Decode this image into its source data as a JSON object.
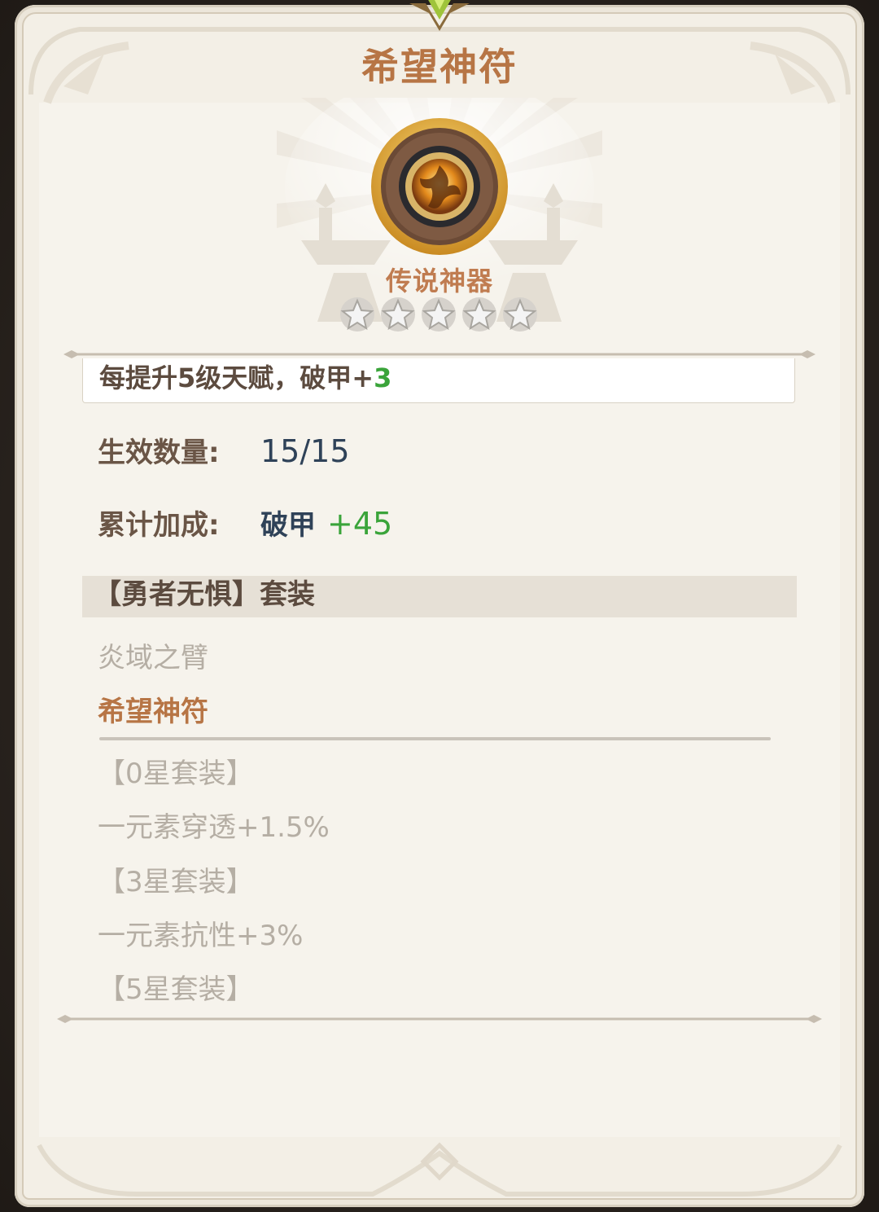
{
  "title": "希望神符",
  "rarity_label": "传说神器",
  "star_count": 5,
  "effect": {
    "prefix": "每提升5级天赋，破甲+",
    "value": "3"
  },
  "active_count": {
    "label": "生效数量:",
    "value": "15/15"
  },
  "total_bonus": {
    "label": "累计加成:",
    "stat": "破甲",
    "value": "+45"
  },
  "set": {
    "header": "【勇者无惧】套装",
    "pieces": [
      "炎域之臂",
      "希望神符"
    ],
    "bonuses": [
      {
        "tier": "【0星套装】",
        "effect": "一元素穿透+1.5%"
      },
      {
        "tier": "【3星套装】",
        "effect": "一元素抗性+3%"
      },
      {
        "tier": "【5星套装】"
      }
    ]
  },
  "colors": {
    "title": "#b77545",
    "highlight_green": "#3aa43a",
    "value_blue": "#2f4258",
    "inactive_grey": "#b5aea4"
  },
  "icons": {
    "artifact": "hope-rune-artifact-icon",
    "star": "silver-star-icon",
    "gem": "green-gem-icon"
  }
}
